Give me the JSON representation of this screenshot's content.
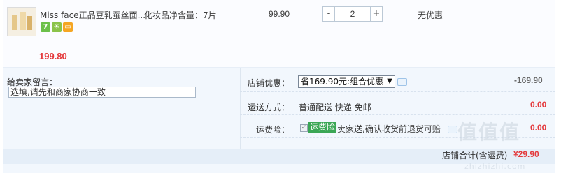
{
  "item": {
    "name": "Miss face正品豆乳蚕丝面...",
    "spec": "化妆品净含量：7片",
    "unit_price": "99.90",
    "quantity": "2",
    "qty_minus": "-",
    "qty_plus": "+",
    "promo": "无优惠",
    "subtotal": "199.80",
    "badges": [
      "7",
      "☀",
      "▭"
    ]
  },
  "message": {
    "label": "给卖家留言：",
    "value": "选填,请先和商家协商一致"
  },
  "options": {
    "shop_discount_label": "店铺优惠：",
    "shop_discount_selected": "省169.90元:组合优惠",
    "shop_discount_amount": "-169.90",
    "shipping_label": "运送方式：",
    "shipping_value": "普通配送 快递 免邮",
    "shipping_amount": "0.00",
    "insurance_label": "运费险：",
    "insurance_tag": "运费险",
    "insurance_text": "卖家送,确认收货前退货可赔",
    "insurance_amount": "0.00"
  },
  "total": {
    "label": "店铺合计(含运费)",
    "value": "¥29.90"
  },
  "watermark": {
    "text": "值值值",
    "sub": "zhizhizhi.com"
  },
  "colors": {
    "price_red": "#e4393c",
    "insurance_green": "#3aa655"
  }
}
